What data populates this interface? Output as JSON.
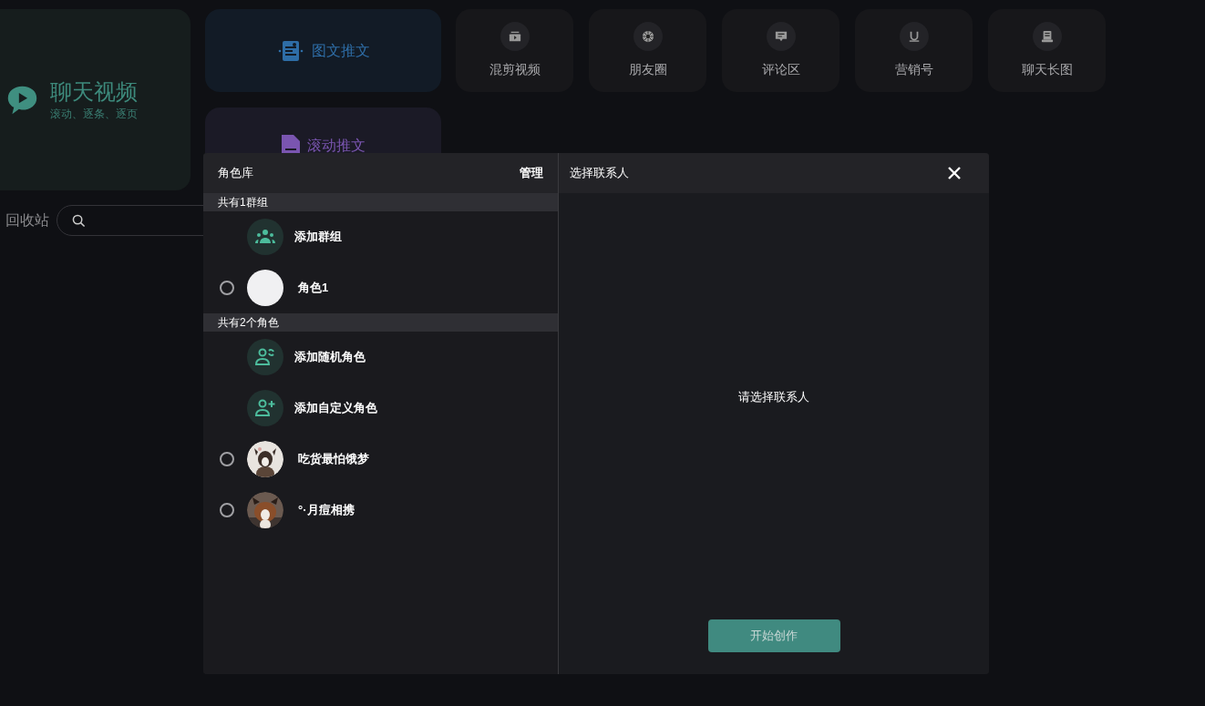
{
  "background": {
    "hero": {
      "title": "聊天视频",
      "subtitle": "滚动、逐条、逐页"
    },
    "feature_cards": [
      {
        "label": "图文推文"
      },
      {
        "label": "滚动推文"
      }
    ],
    "tools": [
      {
        "label": "混剪视频"
      },
      {
        "label": "朋友圈"
      },
      {
        "label": "评论区"
      },
      {
        "label": "营销号"
      },
      {
        "label": "聊天长图"
      }
    ],
    "recycle_label": "回收站"
  },
  "dialog": {
    "left": {
      "title": "角色库",
      "manage": "管理",
      "sections": [
        {
          "header": "共有1群组",
          "items": [
            {
              "kind": "action",
              "label": "添加群组"
            },
            {
              "kind": "role",
              "label": "角色1",
              "selected": false
            }
          ]
        },
        {
          "header": "共有2个角色",
          "items": [
            {
              "kind": "action",
              "label": "添加随机角色"
            },
            {
              "kind": "action",
              "label": "添加自定义角色"
            },
            {
              "kind": "role",
              "label": "吃货最怕饿梦",
              "selected": false
            },
            {
              "kind": "role",
              "label": "°·月痘相携",
              "selected": false
            }
          ]
        }
      ]
    },
    "right": {
      "title": "选择联系人",
      "empty_text": "请选择联系人",
      "start_button": "开始创作"
    }
  }
}
